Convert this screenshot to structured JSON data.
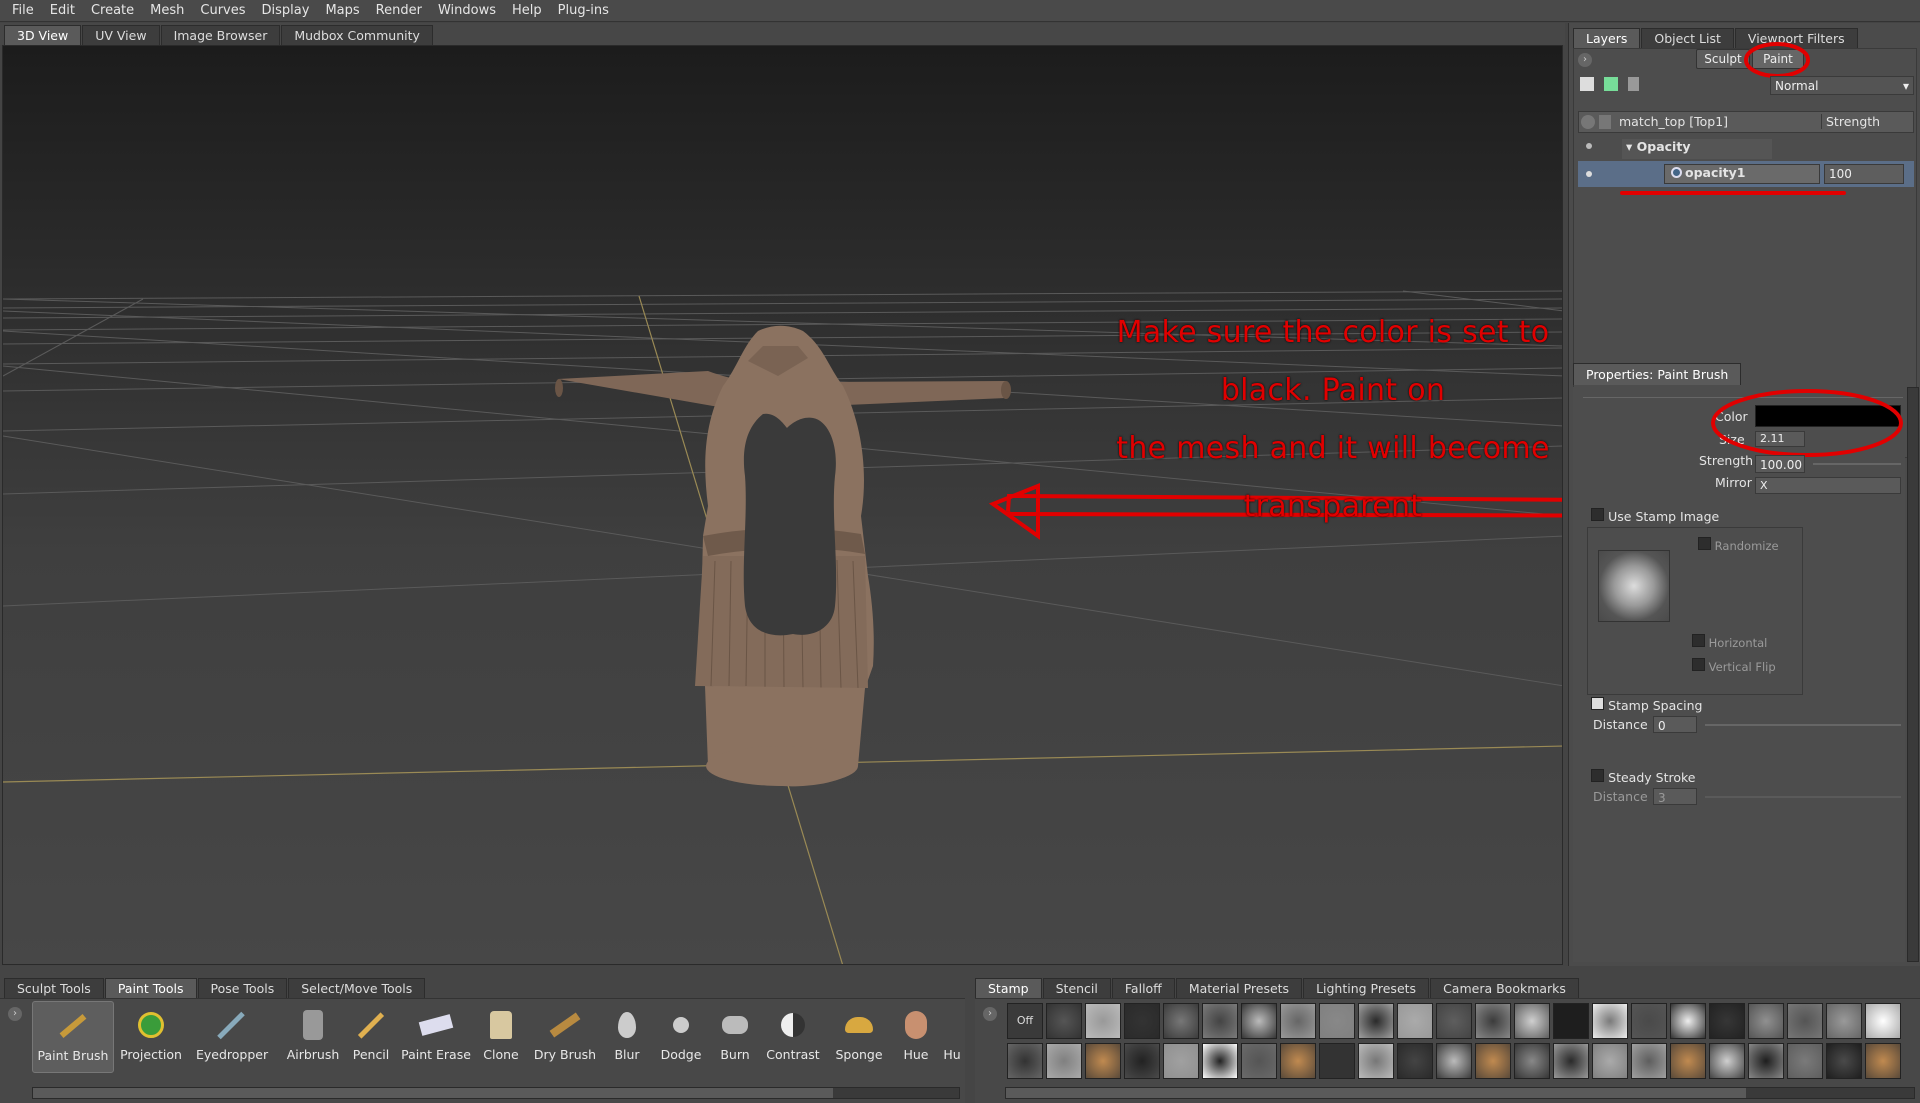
{
  "menu": [
    "File",
    "Edit",
    "Create",
    "Mesh",
    "Curves",
    "Display",
    "Maps",
    "Render",
    "Windows",
    "Help",
    "Plug-ins"
  ],
  "view_tabs": [
    "3D View",
    "UV View",
    "Image Browser",
    "Mudbox Community"
  ],
  "right_tabs": [
    "Layers",
    "Object List",
    "Viewport Filters"
  ],
  "layers": {
    "sculpt_label": "Sculpt",
    "paint_label": "Paint",
    "blend_mode": "Normal",
    "header_name": "match_top [Top1]",
    "header_strength": "Strength",
    "group_name": "Opacity",
    "layer_name": "opacity1",
    "layer_value": "100"
  },
  "properties": {
    "tab": "Properties: Paint Brush",
    "color_label": "Color",
    "size_label": "Size",
    "size_value": "2.11",
    "strength_label": "Strength",
    "strength_value": "100.00",
    "mirror_label": "Mirror",
    "mirror_value": "X",
    "use_stamp_image": "Use Stamp Image",
    "randomize": "Randomize",
    "horizontal": "Horizontal",
    "vertical_flip": "Vertical Flip",
    "stamp_spacing": "Stamp Spacing",
    "distance_label": "Distance",
    "distance_value": "0",
    "steady_stroke": "Steady Stroke",
    "steady_distance_label": "Distance",
    "steady_distance_value": "3"
  },
  "annotation": {
    "line1": "Make sure the color is set to black. Paint on",
    "line2": "the mesh and it will become transparent"
  },
  "tool_tabs": [
    "Sculpt Tools",
    "Paint Tools",
    "Pose Tools",
    "Select/Move Tools"
  ],
  "tools": [
    "Paint Brush",
    "Projection",
    "Eyedropper",
    "Airbrush",
    "Pencil",
    "Paint Erase",
    "Clone",
    "Dry Brush",
    "Blur",
    "Dodge",
    "Burn",
    "Contrast",
    "Sponge",
    "Hue",
    "Hu"
  ],
  "stamp_tabs": [
    "Stamp",
    "Stencil",
    "Falloff",
    "Material Presets",
    "Lighting Presets",
    "Camera Bookmarks"
  ],
  "stamp_off": "Off",
  "colors": {
    "annotation": "#e10000",
    "mesh": "#8b7260",
    "paint_color": "#000000"
  }
}
